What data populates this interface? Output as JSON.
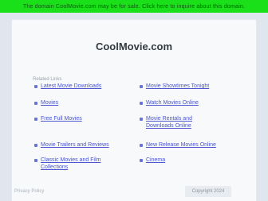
{
  "banner": {
    "text": "The domain CoolMovie.com may be for sale. Click here to inquire about this domain."
  },
  "site": {
    "title": "CoolMovie.com"
  },
  "related": {
    "label": "Related Links"
  },
  "links": [
    "Latest Movie Downloads",
    "Movie Showtimes Tonight",
    "Movies",
    "Watch Movies Online",
    "Free Full Movies",
    "Movie Rentals and Downloads Online",
    "Movie Trailers and Reviews",
    "New Release Movies Online",
    "Classic Movies and Film Collections",
    "Cinema"
  ],
  "footer": {
    "left": "Privacy Policy",
    "right": "Copyright 2024"
  }
}
